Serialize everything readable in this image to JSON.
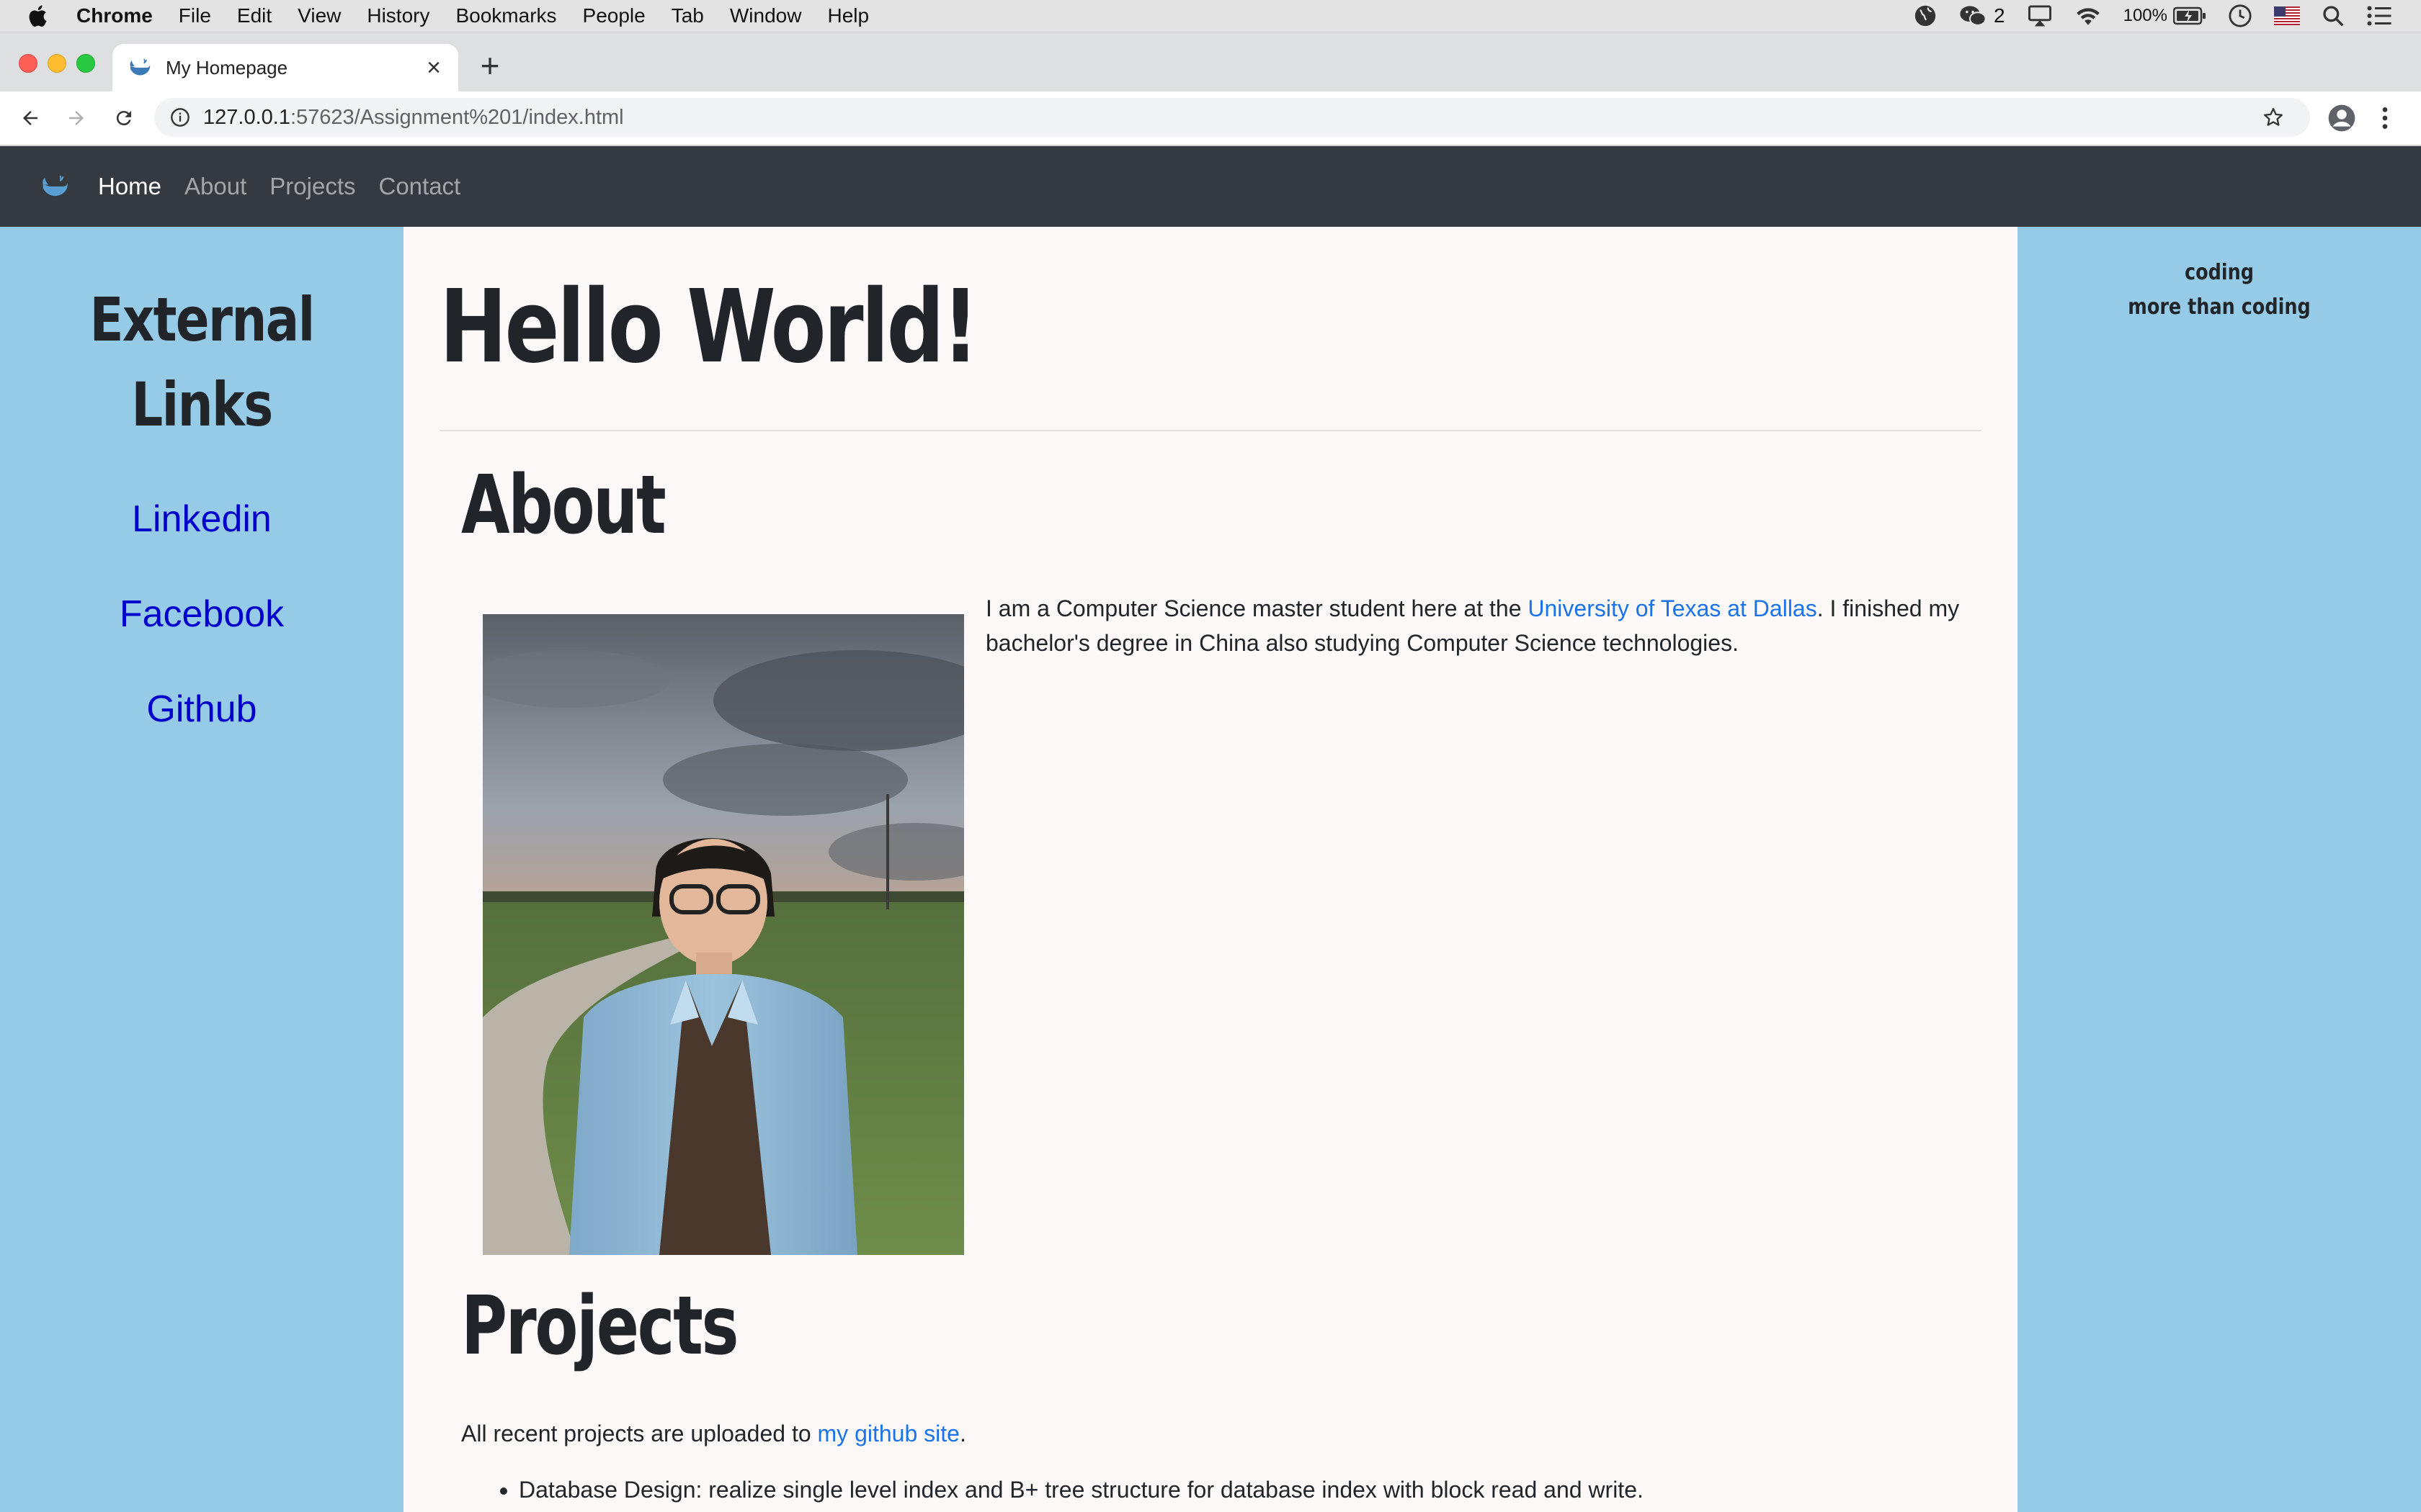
{
  "menubar": {
    "app_name": "Chrome",
    "items": [
      "File",
      "Edit",
      "View",
      "History",
      "Bookmarks",
      "People",
      "Tab",
      "Window",
      "Help"
    ],
    "wechat_count": "2",
    "battery": "100%"
  },
  "browser": {
    "tab_title": "My Homepage",
    "url_host": "127.0.0.1",
    "url_path": ":57623/Assignment%201/index.html"
  },
  "navbar": {
    "links": [
      "Home",
      "About",
      "Projects",
      "Contact"
    ],
    "active": "Home"
  },
  "left_sidebar": {
    "title_line1": "External",
    "title_line2": "Links",
    "links": [
      "Linkedin",
      "Facebook",
      "Github"
    ]
  },
  "right_sidebar": {
    "line1": "coding",
    "line2": "more than coding"
  },
  "main": {
    "heading": "Hello World!",
    "about_title": "About",
    "about_text_before": "I am a Computer Science master student here at the ",
    "about_link": "University of Texas at Dallas",
    "about_text_after": ". I finished my bachelor's degree in China also studying Computer Science technologies.",
    "projects_title": "Projects",
    "projects_text_before": "All recent projects are uploaded to ",
    "projects_link": "my github site",
    "projects_text_after": ".",
    "projects_items": [
      "Database Design: realize single level index and B+ tree structure for database index with block read and write."
    ]
  },
  "colors": {
    "sidebar": "#96cbe8",
    "navbar": "#343a40",
    "main_bg": "#fcf8f7",
    "link_blue": "#1a73e8",
    "external_link": "#0000cc"
  }
}
